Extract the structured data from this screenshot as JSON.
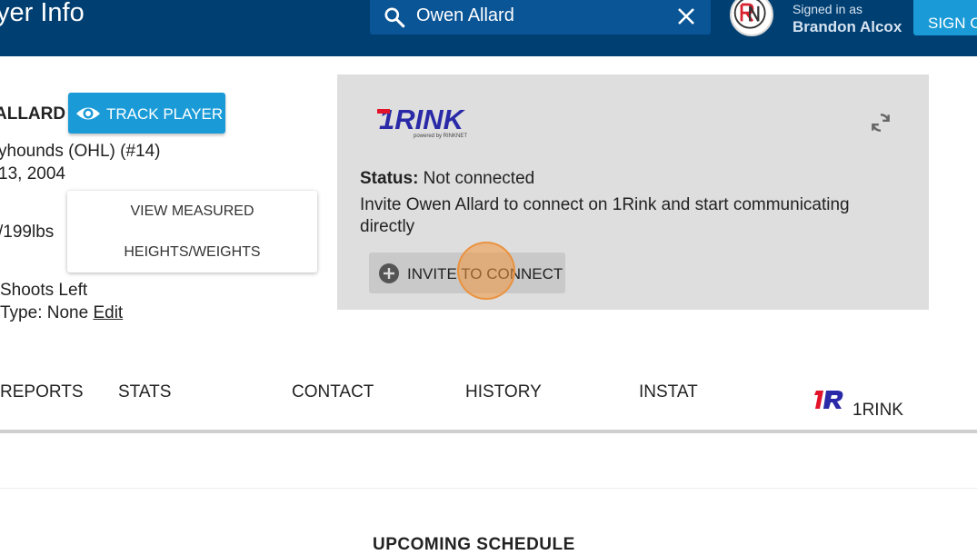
{
  "header": {
    "page_title": "yer Info",
    "search_value": "Owen Allard",
    "signed_in_label": "Signed in as",
    "user_name": "Brandon Alcox",
    "sign_out_label": "SIGN O"
  },
  "player": {
    "name": "ALLARD",
    "track_label": "TRACK PLAYER",
    "team_line": "yhounds (OHL) (#14)",
    "dob_line": " 13, 2004",
    "weight_line": "/199lbs",
    "shoots_line": "Shoots Left",
    "type_line": "Type:  None ",
    "edit_label": "Edit",
    "measure_line1": "VIEW MEASURED",
    "measure_line2": "HEIGHTS/WEIGHTS"
  },
  "rink": {
    "brand": "1RINK",
    "tagline": "powered by RINKNET",
    "status_label": "Status:",
    "status_value": " Not connected",
    "invite_text": "Invite Owen Allard to connect on 1Rink and start communicating directly",
    "invite_button": "INVITE TO CONNECT"
  },
  "tabs": [
    "REPORTS",
    "STATS",
    "CONTACT",
    "HISTORY",
    "INSTAT",
    "1RINK"
  ],
  "schedule": {
    "title": "UPCOMING SCHEDULE"
  },
  "colors": {
    "header_bg": "#003f72",
    "accent": "#1a9bd7",
    "rink_red": "#e3122b",
    "rink_blue": "#2a2aa8",
    "panel_bg": "#dedede"
  },
  "icons": {
    "search": "search-icon",
    "clear": "close-icon",
    "eye": "eye-icon",
    "refresh": "refresh-icon",
    "plus": "plus-circle-icon"
  }
}
